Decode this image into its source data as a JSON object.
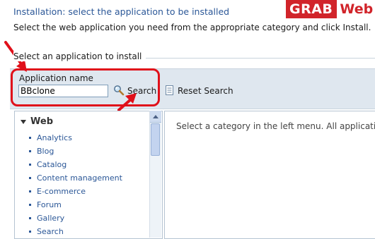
{
  "header": {
    "heading": "Installation: select the application to be installed",
    "instructions": "Select the web application you need from the appropriate category and click Install."
  },
  "watermark": {
    "part1": "GRAB",
    "part2": "Web"
  },
  "section": {
    "title": "Select an application to install"
  },
  "search": {
    "label": "Application name",
    "value": "BBclone",
    "search_label": "Search",
    "reset_label": "Reset Search"
  },
  "categories": {
    "group_label": "Web",
    "items": [
      "Analytics",
      "Blog",
      "Catalog",
      "Content management",
      "E-commerce",
      "Forum",
      "Gallery",
      "Search"
    ]
  },
  "right_panel": {
    "message": "Select a category in the left menu. All applications a"
  },
  "colors": {
    "highlight": "#e0101a",
    "link": "#2b5797",
    "bar": "#dfe7ef"
  }
}
